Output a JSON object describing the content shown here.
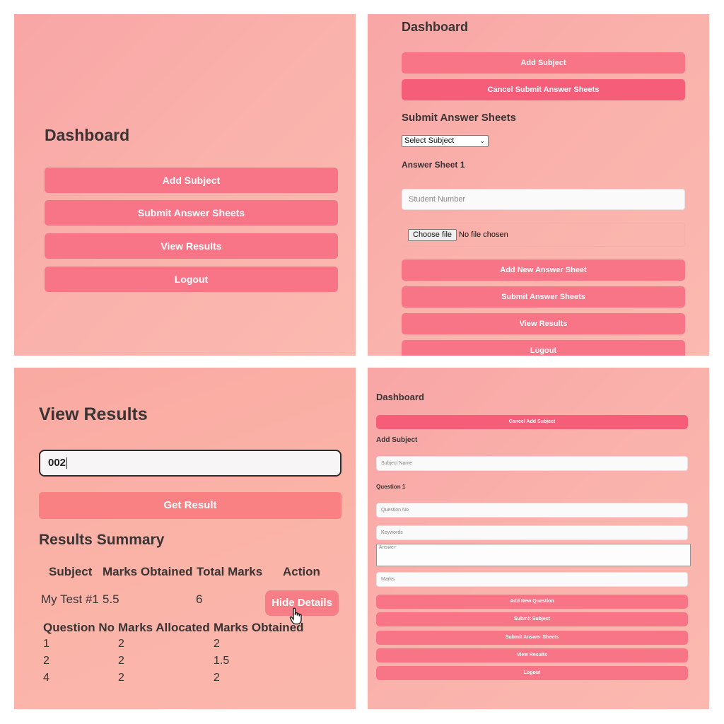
{
  "colors": {
    "button": "#f87587",
    "button_active": "#f65d79",
    "title": "#3b3434",
    "background": "#fab3ac"
  },
  "panel1": {
    "title": "Dashboard",
    "buttons": [
      "Add Subject",
      "Submit Answer Sheets",
      "View Results",
      "Logout"
    ]
  },
  "panel2": {
    "title": "Dashboard",
    "add_subject": "Add Subject",
    "cancel_submit": "Cancel Submit Answer Sheets",
    "section_title": "Submit Answer Sheets",
    "select_value": "Select Subject",
    "answer_sheet_label": "Answer Sheet 1",
    "student_number_placeholder": "Student Number",
    "choose_file": "Choose file",
    "no_file": "No file chosen",
    "buttons": [
      "Add New Answer Sheet",
      "Submit Answer Sheets",
      "View Results",
      "Logout"
    ]
  },
  "panel3": {
    "title": "View Results",
    "input_value": "002",
    "get_result": "Get Result",
    "summary_title": "Results Summary",
    "summary_headers": [
      "Subject",
      "Marks Obtained",
      "Total Marks",
      "Action"
    ],
    "summary_row": {
      "subject": "My Test #1",
      "marks_obtained": "5.5",
      "total_marks": "6",
      "action": "Hide Details"
    },
    "detail_headers": [
      "Question No",
      "Marks Allocated",
      "Marks Obtained"
    ],
    "detail_rows": [
      [
        "1",
        "2",
        "2"
      ],
      [
        "2",
        "2",
        "1.5"
      ],
      [
        "4",
        "2",
        "2"
      ]
    ]
  },
  "panel4": {
    "title": "Dashboard",
    "cancel_add": "Cancel Add Subject",
    "section_title": "Add Subject",
    "subject_name_placeholder": "Subject Name",
    "question_label": "Question 1",
    "question_no_placeholder": "Question No",
    "keywords_placeholder": "Keywords",
    "answer_placeholder": "Answer",
    "marks_placeholder": "Marks",
    "buttons": [
      "Add New Question",
      "Submit Subject",
      "Submit Answer Sheets",
      "View Results",
      "Logout"
    ]
  }
}
